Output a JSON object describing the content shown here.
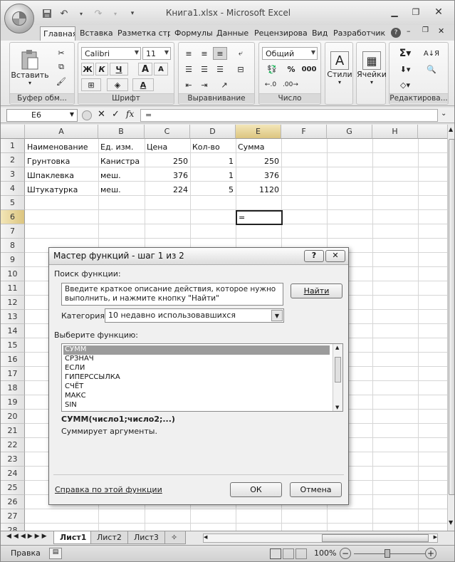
{
  "app": {
    "title": "Книга1.xlsx - Microsoft Excel"
  },
  "qat": {
    "save_icon": "save-icon",
    "undo_icon": "undo-icon",
    "redo_icon": "redo-icon"
  },
  "tabs": [
    "Главная",
    "Вставка",
    "Разметка стра",
    "Формулы",
    "Данные",
    "Рецензирова",
    "Вид",
    "Разработчик"
  ],
  "ribbon": {
    "clipboard": {
      "paste": "Вставить",
      "label": "Буфер обм..."
    },
    "font": {
      "name": "Calibri",
      "size": "11",
      "bold": "Ж",
      "italic": "К",
      "underline": "Ч",
      "grow": "A",
      "shrink": "A",
      "label": "Шрифт"
    },
    "alignment": {
      "label": "Выравнивание"
    },
    "number": {
      "format": "Общий",
      "percent": "%",
      "thousands": "000",
      "label": "Число"
    },
    "styles": {
      "label": "Стили"
    },
    "cells": {
      "label": "Ячейки"
    },
    "editing": {
      "label": "Редактирова..."
    }
  },
  "formula_bar": {
    "cell_ref": "E6",
    "fx": "fx",
    "content": "="
  },
  "columns": [
    "A",
    "B",
    "C",
    "D",
    "E",
    "F",
    "G",
    "H"
  ],
  "rows": [
    "1",
    "2",
    "3",
    "4",
    "5",
    "6",
    "7",
    "8",
    "9",
    "10",
    "11",
    "12",
    "13",
    "14",
    "15",
    "16",
    "17",
    "18",
    "19",
    "20",
    "21",
    "22",
    "23",
    "24",
    "25",
    "26",
    "27",
    "28"
  ],
  "cells": {
    "A1": "Наименование",
    "B1": "Ед. изм.",
    "C1": "Цена",
    "D1": "Кол-во",
    "E1": "Сумма",
    "A2": "Грунтовка",
    "B2": "Канистра",
    "C2": "250",
    "D2": "1",
    "E2": "250",
    "A3": "Шпаклевка",
    "B3": "меш.",
    "C3": "376",
    "D3": "1",
    "E3": "376",
    "A4": "Штукатурка",
    "B4": "меш.",
    "C4": "224",
    "D4": "5",
    "E4": "1120",
    "E6": "="
  },
  "sheet_tabs": [
    "Лист1",
    "Лист2",
    "Лист3"
  ],
  "status": {
    "mode": "Правка",
    "zoom": "100%"
  },
  "dialog": {
    "title": "Мастер функций - шаг 1 из 2",
    "help_btn": "?",
    "close_btn": "✕",
    "search_label": "Поиск функции:",
    "search_text": "Введите краткое описание действия, которое нужно выполнить, и нажмите кнопку \"Найти\"",
    "find_button": "Найти",
    "category_label": "Категория:",
    "category_value": "10 недавно использовавшихся",
    "select_label": "Выберите функцию:",
    "functions": [
      "СУММ",
      "СРЗНАЧ",
      "ЕСЛИ",
      "ГИПЕРССЫЛКА",
      "СЧЁТ",
      "МАКС",
      "SIN"
    ],
    "selected_function": "СУММ",
    "signature": "СУММ(число1;число2;...)",
    "description": "Суммирует аргументы.",
    "help_link": "Справка по этой функции",
    "ok": "ОК",
    "cancel": "Отмена"
  }
}
